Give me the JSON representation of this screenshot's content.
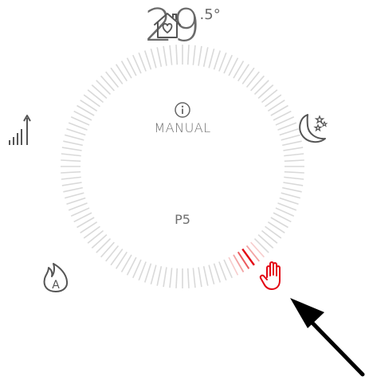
{
  "dial": {
    "mode_label": "MANUAL",
    "temperature_integer": "29",
    "temperature_decimal": ".5°",
    "program": "P5",
    "setpoint_fraction": 0.7,
    "tick_count": 120,
    "track_color": "#d9d9d9",
    "active_color": "#e30613"
  },
  "icons": {
    "top": "home-heart-icon",
    "left": "signal-bars-icon",
    "right": "moon-stars-icon",
    "bottom_left": "auto-flame-icon",
    "bottom_right": "hand-manual-icon",
    "center_info": "info-icon"
  }
}
